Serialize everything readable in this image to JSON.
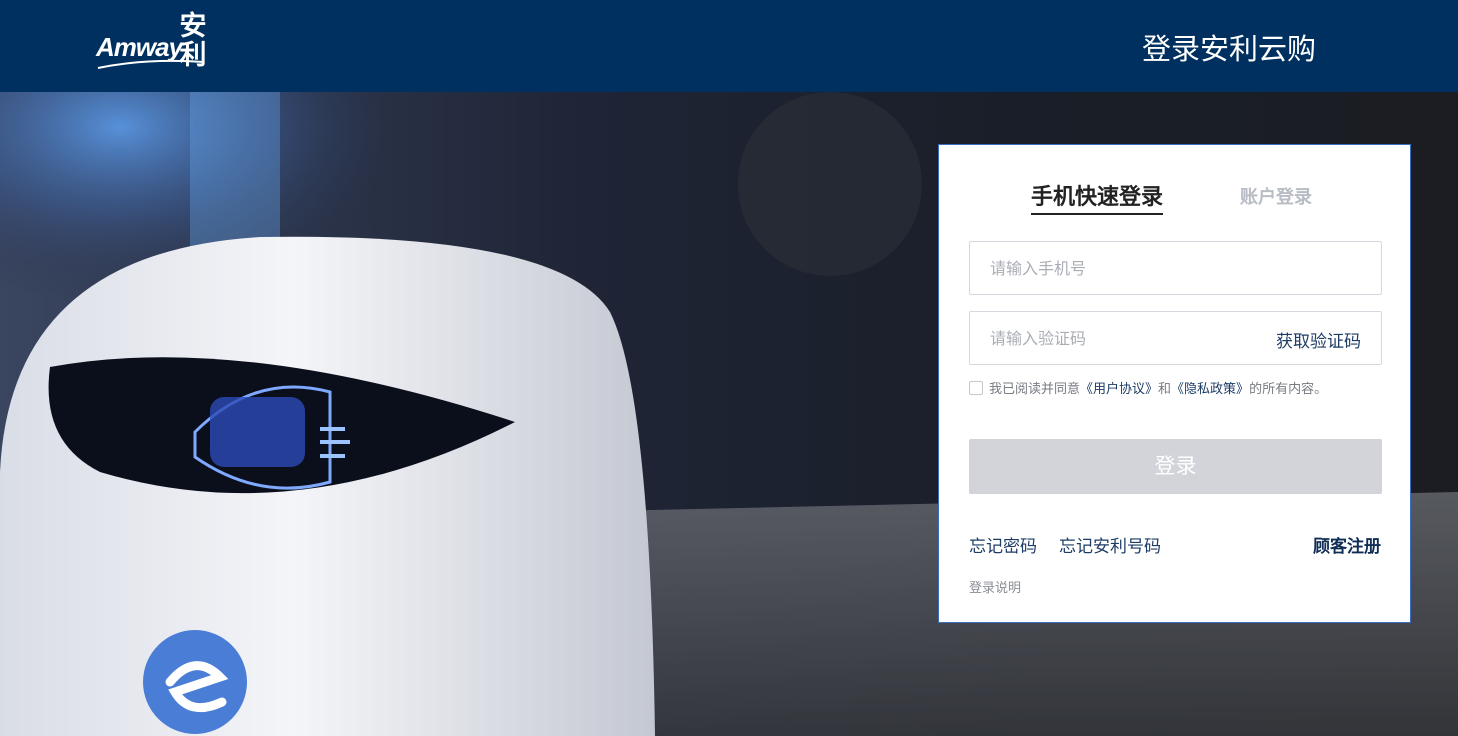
{
  "brand": {
    "logo_text": "Amway",
    "logo_zh": "安利",
    "bg_color": "#00305f"
  },
  "header": {
    "title": "登录安利云购"
  },
  "login": {
    "tabs": [
      {
        "label": "手机快速登录",
        "active": true
      },
      {
        "label": "账户登录",
        "active": false
      }
    ],
    "phone_placeholder": "请输入手机号",
    "code_placeholder": "请输入验证码",
    "get_code_label": "获取验证码",
    "agreement": {
      "checked": false,
      "prefix": "我已阅读并同意",
      "user_agreement": "《用户协议》",
      "and": "和",
      "privacy_policy": "《隐私政策》",
      "suffix": "的所有内容。"
    },
    "submit_label": "登录",
    "forgot_password": "忘记密码",
    "forgot_amway_number": "忘记安利号码",
    "register": "顾客注册",
    "login_notes": "登录说明"
  }
}
